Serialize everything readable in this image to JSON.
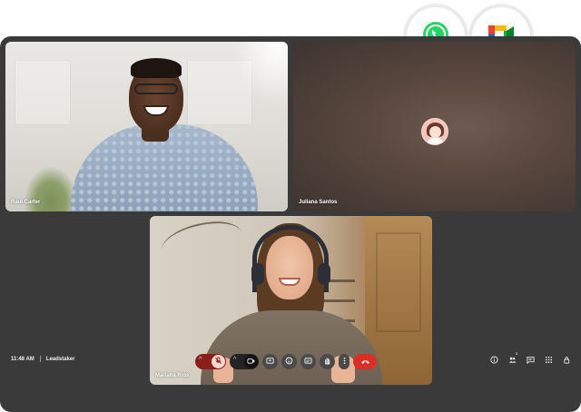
{
  "participants": [
    {
      "name": "Raul Carter"
    },
    {
      "name": "Juliana Santos"
    },
    {
      "name": "Mariana Rios"
    }
  ],
  "footer": {
    "time": "11:48 AM",
    "meeting_name": "Leadstaker"
  },
  "people_count": "3",
  "icons": {
    "whatsapp": "whatsapp-icon",
    "meet": "google-meet-icon",
    "mic": "mic-off-icon",
    "camera": "camera-icon",
    "present": "present-screen-icon",
    "emoji": "emoji-icon",
    "captions": "captions-icon",
    "hand": "raise-hand-icon",
    "more": "more-options-icon",
    "end": "end-call-icon",
    "info": "info-icon",
    "people": "people-icon",
    "chat": "chat-icon",
    "activities": "activities-icon",
    "host": "host-controls-icon"
  },
  "colors": {
    "window_bg": "#3a3a3a",
    "end_call": "#d93025",
    "mic_muted": "#8a1f1a",
    "whatsapp": "#25d366"
  }
}
